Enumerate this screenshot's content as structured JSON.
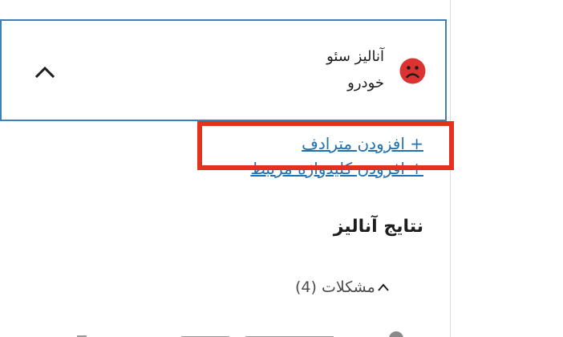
{
  "panel": {
    "title_line1": "آنالیز سئو",
    "title_line2": "خودرو",
    "status_icon": "sad-face-icon",
    "status_color": "#dc3232",
    "toggle_icon": "chevron-up-icon"
  },
  "links": {
    "add_synonym": "+ افزودن مترادف",
    "add_related_keyphrase": "+ افزودن کلیدواژه مرتبط"
  },
  "results": {
    "heading": "نتایج آنالیز",
    "problems_label": "مشکلات (4)",
    "problems_icon": "chevron-up-icon"
  },
  "colors": {
    "accent": "#2271b1",
    "panel_border": "#3d7fb8",
    "highlight": "#e2311d"
  }
}
